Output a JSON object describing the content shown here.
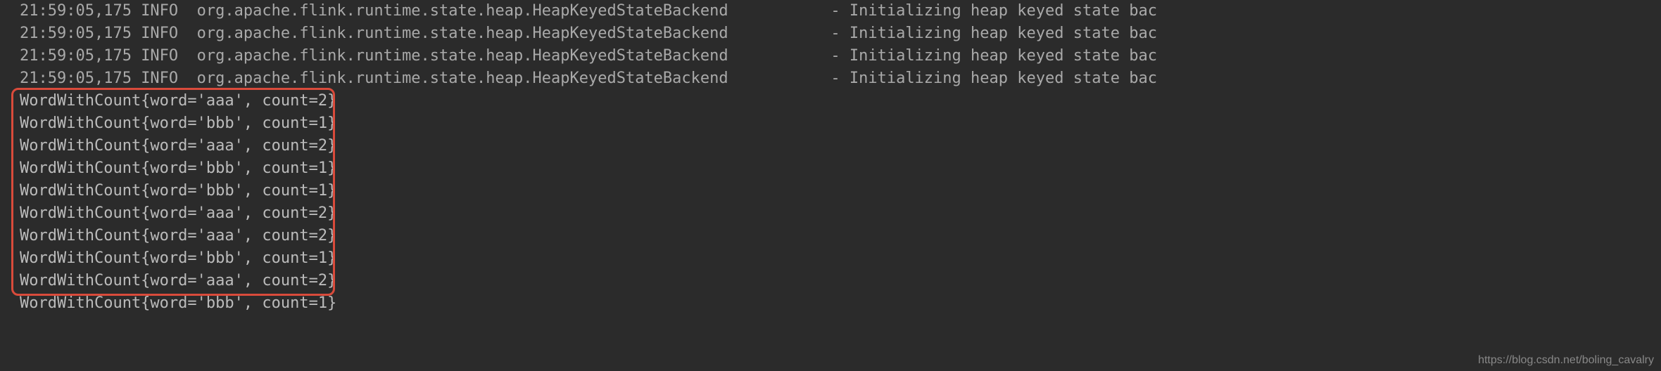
{
  "logs": [
    {
      "time": "21:59:05,175",
      "level": "INFO",
      "class": "org.apache.flink.runtime.state.heap.HeapKeyedStateBackend",
      "msg": "Initializing heap keyed state bac"
    },
    {
      "time": "21:59:05,175",
      "level": "INFO",
      "class": "org.apache.flink.runtime.state.heap.HeapKeyedStateBackend",
      "msg": "Initializing heap keyed state bac"
    },
    {
      "time": "21:59:05,175",
      "level": "INFO",
      "class": "org.apache.flink.runtime.state.heap.HeapKeyedStateBackend",
      "msg": "Initializing heap keyed state bac"
    },
    {
      "time": "21:59:05,175",
      "level": "INFO",
      "class": "org.apache.flink.runtime.state.heap.HeapKeyedStateBackend",
      "msg": "Initializing heap keyed state bac"
    }
  ],
  "outputs": [
    "WordWithCount{word='aaa', count=2}",
    "WordWithCount{word='bbb', count=1}",
    "WordWithCount{word='aaa', count=2}",
    "WordWithCount{word='bbb', count=1}",
    "WordWithCount{word='bbb', count=1}",
    "WordWithCount{word='aaa', count=2}",
    "WordWithCount{word='aaa', count=2}",
    "WordWithCount{word='bbb', count=1}",
    "WordWithCount{word='aaa', count=2}",
    "WordWithCount{word='bbb', count=1}"
  ],
  "spacing": {
    "afterLevel": "  ",
    "afterClass": "           ",
    "dash": "- "
  },
  "watermark": "https://blog.csdn.net/boling_cavalry"
}
